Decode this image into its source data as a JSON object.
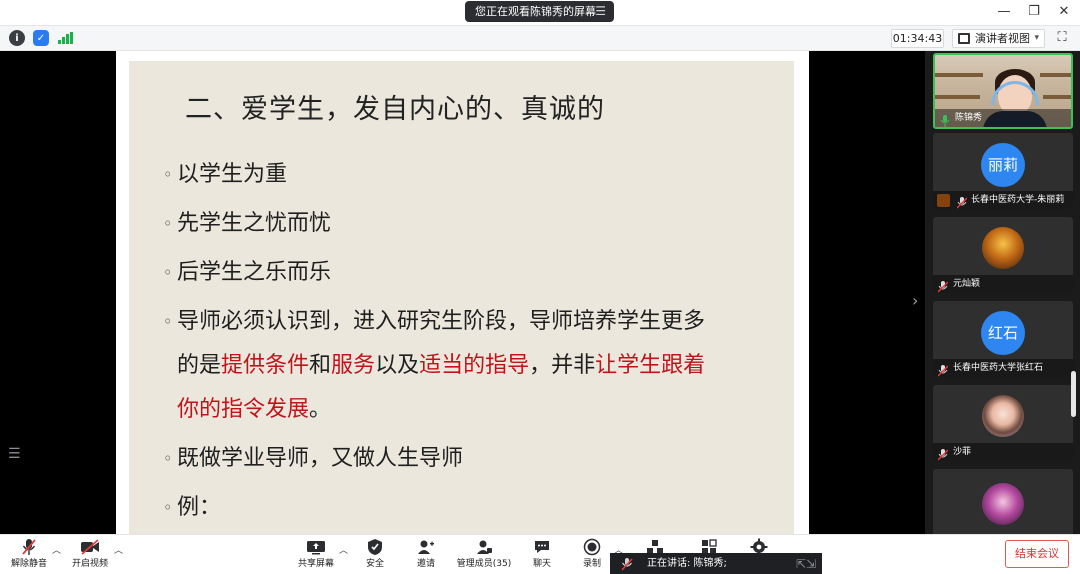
{
  "titlebar": {
    "share_banner": "您正在观看陈锦秀的屏幕",
    "menu_icon": "menu-lines-icon",
    "minimize_glyph": "—",
    "restore_glyph": "❐",
    "close_glyph": "✕"
  },
  "subbar": {
    "timer": "01:34:43",
    "view_mode": "演讲者视图",
    "view_caret": "▾",
    "fullscreen_glyph": "⛶"
  },
  "slide": {
    "title": "二、爱学生，发自内心的、真诚的",
    "bullets": {
      "b1": "以学生为重",
      "b2": "先学生之忧而忧",
      "b3": "后学生之乐而乐",
      "b4_line1": "导师必须认识到，进入研究生阶段，导师培养学生更多",
      "b4_p1": "的是",
      "b4_r1": "提供条件",
      "b4_p2": "和",
      "b4_r2": "服务",
      "b4_p3": "以及",
      "b4_r3": "适当的指导",
      "b4_p4": "，并非",
      "b4_r4": "让学生跟着",
      "b4_r5": "你的指令发展",
      "b4_p5": "。",
      "b5": "既做学业导师，又做人生导师",
      "b6": "例："
    },
    "accent_color": "#c0141b"
  },
  "participants": [
    {
      "name": "陈锦秀",
      "avatar": ""
    },
    {
      "name": "长春中医药大学-朱丽莉",
      "avatar": "丽莉"
    },
    {
      "name": "元灿颖",
      "avatar": ""
    },
    {
      "name": "长春中医药大学张红石",
      "avatar": "红石"
    },
    {
      "name": "沙菲",
      "avatar": ""
    }
  ],
  "toolbar": {
    "unmute": "解除静音",
    "start_video": "开启视频",
    "share_screen": "共享屏幕",
    "security": "安全",
    "invite": "邀请",
    "manage_members": "管理成员(35)",
    "chat": "聊天",
    "record": "录制",
    "speaking": "正在讲话: 陈锦秀;",
    "end_meeting": "结束会议"
  },
  "colors": {
    "avatar_blue": "#2e86f0",
    "active_border": "#3cc05a",
    "end_red": "#d9322f"
  }
}
